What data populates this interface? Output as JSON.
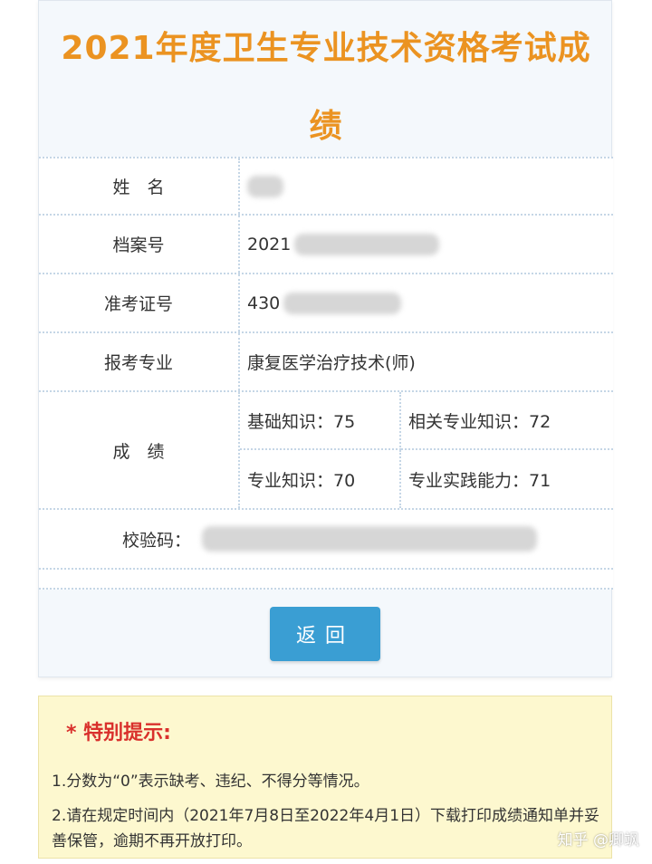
{
  "header": {
    "title_line1": "2021年度卫生专业技术资格考试成",
    "title_line2": "绩"
  },
  "table": {
    "name_label": "姓　名",
    "file_no_label": "档案号",
    "file_no_value": "2021",
    "admission_label": "准考证号",
    "admission_value": "430",
    "major_label": "报考专业",
    "major_value": "康复医学治疗技术(师)",
    "score_label": "成　绩",
    "scores": {
      "basic": "基础知识：75",
      "related": "相关专业知识：72",
      "professional": "专业知识：70",
      "practice": "专业实践能力：71"
    },
    "check_label": "校验码："
  },
  "actions": {
    "back_label": "返回"
  },
  "notice": {
    "title": "* 特别提示:",
    "line1": "1.分数为“0”表示缺考、违纪、不得分等情况。",
    "line2": "2.请在规定时间内（2021年7月8日至2022年4月1日）下载打印成绩通知单并妥善保管，逾期不再开放打印。"
  },
  "watermark": "知乎 @卿飒",
  "colors": {
    "title": "#eb9321",
    "button": "#3a9ed3",
    "notice_bg": "#fdf8cf",
    "notice_title": "#d9302c"
  }
}
